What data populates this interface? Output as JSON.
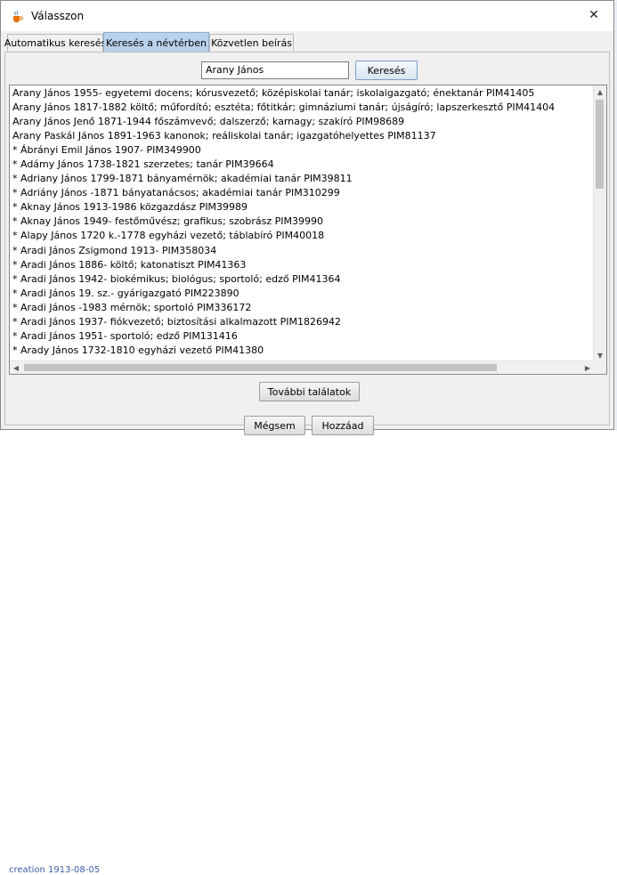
{
  "window": {
    "title": "Válasszon",
    "close_glyph": "✕"
  },
  "tabs": [
    {
      "label": "Automatikus keresés",
      "active": false
    },
    {
      "label": "Keresés a névtérben",
      "active": true
    },
    {
      "label": "Közvetlen beírás",
      "active": false
    }
  ],
  "search": {
    "value": "Arany János",
    "button_label": "Keresés"
  },
  "results": [
    "Arany János 1955- egyetemi docens; kórusvezető; középiskolai tanár; iskolaigazgató; énektanár  PIM41405",
    "Arany János 1817-1882 költő; műfordító; esztéta; főtitkár; gimnáziumi tanár; újságíró; lapszerkesztő  PIM41404",
    "Arany János Jenő 1871-1944 főszámvevő; dalszerző; karnagy; szakíró  PIM98689",
    "Arany Paskál János 1891-1963 kanonok; reáliskolai tanár; igazgatóhelyettes  PIM81137",
    "* Ábrányi Emil János 1907-  PIM349900",
    "* Adámy János 1738-1821 szerzetes; tanár  PIM39664",
    "* Adriany János 1799-1871 bányamérnök; akadémiai tanár  PIM39811",
    "* Adriány János -1871 bányatanácsos; akadémiai tanár  PIM310299",
    "* Aknay János 1913-1986 közgazdász  PIM39989",
    "* Aknay János 1949- festőművész; grafikus; szobrász  PIM39990",
    "* Alapy János 1720 k.-1778 egyházi vezető; táblabíró  PIM40018",
    "* Aradi János Zsigmond 1913-  PIM358034",
    "* Aradi János 1886- költő; katonatiszt  PIM41363",
    "* Aradi János 1942- biokémikus; biológus; sportoló; edző  PIM41364",
    "* Aradi János 19. sz.- gyárigazgató  PIM223890",
    "* Aradi János -1983 mérnök; sportoló  PIM336172",
    "* Aradi János 1937- fiókvezető; biztosítási alkalmazott  PIM1826942",
    "* Aradi János 1951- sportoló; edző  PIM131416",
    "* Arady János 1732-1810 egyházi vezető  PIM41380"
  ],
  "more_button_label": "További találatok",
  "footer": {
    "cancel_label": "Mégsem",
    "add_label": "Hozzáad"
  },
  "background": {
    "bottom_text": "creation  1913-08-05"
  },
  "colors": {
    "active_tab": "#b9d1ea",
    "button_border": "#7a9dc8"
  }
}
